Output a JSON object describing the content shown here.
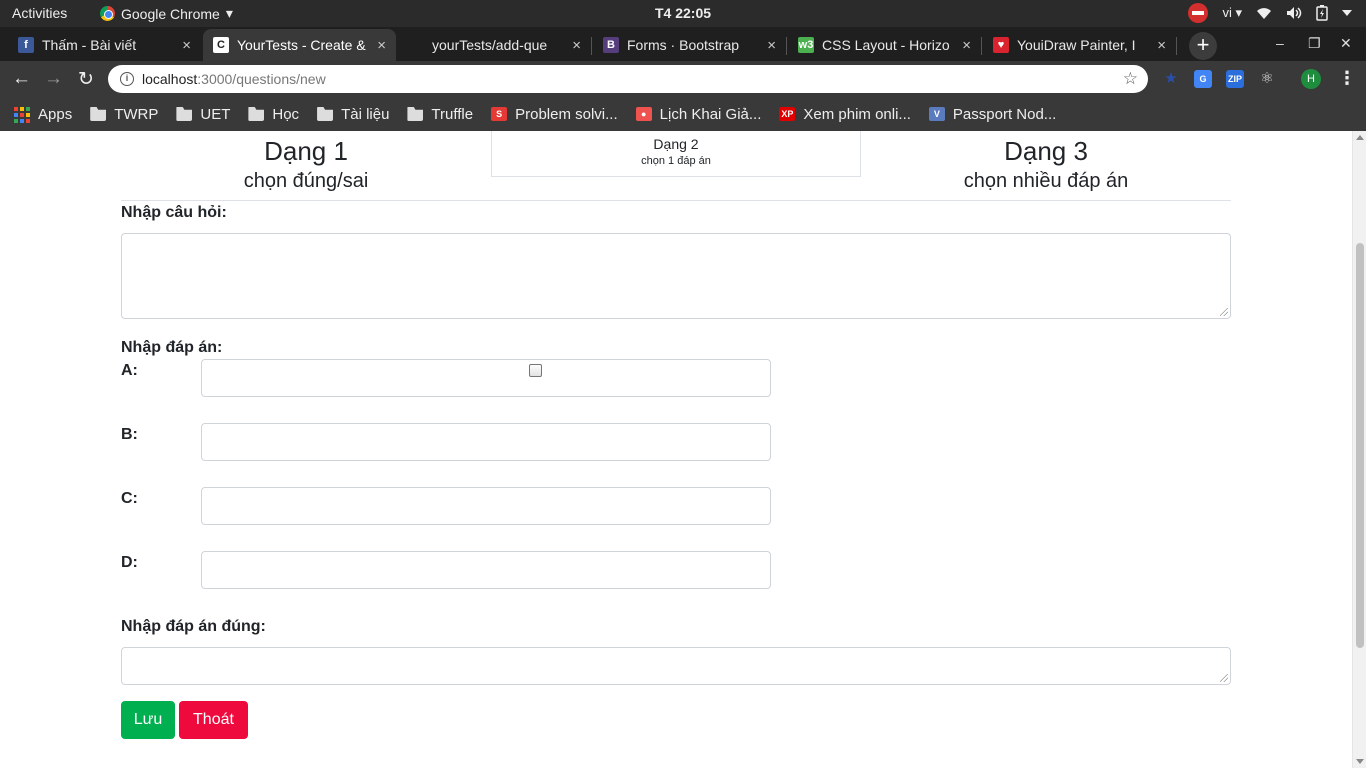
{
  "os_bar": {
    "activities": "Activities",
    "app_name": "Google Chrome",
    "app_menu_arrow": "▾",
    "clock": "T4 22:05",
    "lang": "vi",
    "lang_arrow": "▾"
  },
  "tabs": [
    {
      "title": "Thấm - Bài viết",
      "favicon": "facebook-icon",
      "color": "#3b5998",
      "glyph": "f"
    },
    {
      "title": "YourTests - Create &",
      "favicon": "page-c-icon",
      "color": "#ffffff",
      "glyph": "C",
      "active": true
    },
    {
      "title": "yourTests/add-que",
      "favicon": "github-icon",
      "color": "#1f1f1f",
      "glyph": ""
    },
    {
      "title": "Forms · Bootstrap",
      "favicon": "bootstrap-icon",
      "color": "#563d7c",
      "glyph": "B"
    },
    {
      "title": "CSS Layout - Horizo",
      "favicon": "w3schools-icon",
      "color": "#4caf50",
      "glyph": "w3"
    },
    {
      "title": "YouiDraw Painter, I",
      "favicon": "youidraw-icon",
      "color": "#d9232e",
      "glyph": "♥"
    }
  ],
  "tab_close": "×",
  "new_tab": "+",
  "window_controls": {
    "minimize": "–",
    "maximize": "❐",
    "close": "✕"
  },
  "address_bar": {
    "host": "localhost",
    "path": ":3000/questions/new",
    "info": "i",
    "star": "☆"
  },
  "nav": {
    "back": "←",
    "forward": "→",
    "reload": "↻"
  },
  "extensions": [
    {
      "name": "bookmark-star-ext-icon",
      "color": "#1a3c8c",
      "glyph": "★"
    },
    {
      "name": "google-translate-ext-icon",
      "color": "#4285f4",
      "glyph": "G"
    },
    {
      "name": "zip-ext-icon",
      "color": "#2a6fdb",
      "glyph": "ZIP"
    },
    {
      "name": "react-devtools-ext-icon",
      "color": "#393939",
      "glyph": "⚛"
    }
  ],
  "profile_initial": "H",
  "menu_glyph": "⋮",
  "bookmarks": [
    {
      "label": "Apps",
      "type": "apps"
    },
    {
      "label": "TWRP",
      "type": "folder"
    },
    {
      "label": "UET",
      "type": "folder"
    },
    {
      "label": "Học",
      "type": "folder"
    },
    {
      "label": "Tài liệu",
      "type": "folder"
    },
    {
      "label": "Truffle",
      "type": "folder"
    },
    {
      "label": "Problem solvi...",
      "type": "site",
      "color": "#e53935",
      "glyph": "S"
    },
    {
      "label": "Lịch Khai Giả...",
      "type": "site",
      "color": "#ef5350",
      "glyph": "●"
    },
    {
      "label": "Xem phim onli...",
      "type": "site",
      "color": "#e00000",
      "glyph": "XP"
    },
    {
      "label": "Passport Nod...",
      "type": "site",
      "color": "#5a7bbd",
      "glyph": "V"
    }
  ],
  "question_types": [
    {
      "title": "Dạng 1",
      "subtitle": "chọn đúng/sai"
    },
    {
      "title": "Dạng 2",
      "subtitle": "chọn 1 đáp án",
      "active": true
    },
    {
      "title": "Dạng 3",
      "subtitle": "chọn nhiều đáp án"
    }
  ],
  "form": {
    "question_label": "Nhập câu hỏi:",
    "question_value": "",
    "answers_label": "Nhập đáp án:",
    "options": [
      {
        "label": "A:",
        "value": ""
      },
      {
        "label": "B:",
        "value": ""
      },
      {
        "label": "C:",
        "value": ""
      },
      {
        "label": "D:",
        "value": ""
      }
    ],
    "correct_label": "Nhập đáp án đúng:",
    "correct_value": "",
    "save_label": "Lưu",
    "exit_label": "Thoát"
  },
  "colors": {
    "save": "#00b050",
    "exit": "#ee0a3c"
  }
}
